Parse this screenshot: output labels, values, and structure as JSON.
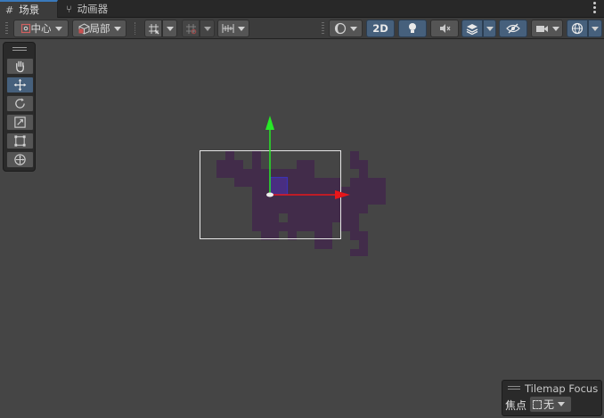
{
  "tabs": [
    {
      "label": "场景",
      "icon": "grid-icon",
      "active": true
    },
    {
      "label": "动画器",
      "icon": "branch-icon",
      "active": false
    }
  ],
  "toolbar": {
    "pivot_label": "中心",
    "space_label": "局部",
    "mode_2d_label": "2D"
  },
  "tilemap_focus": {
    "title": "Tilemap Focus",
    "focus_label": "焦点",
    "focus_value": "无"
  },
  "colors": {
    "scene_bg": "#454545",
    "tile_purple": "#422c4a",
    "accent_blue": "#46607c",
    "y_axis": "#27e827",
    "x_axis": "#e8161a"
  }
}
